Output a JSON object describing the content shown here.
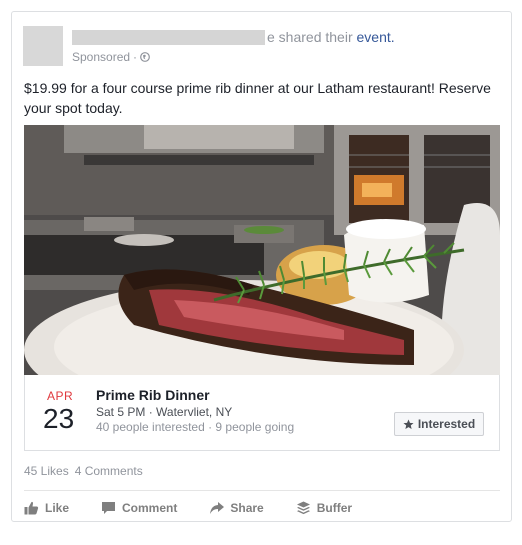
{
  "post": {
    "shared_suffix": "e shared their",
    "shared_link": "event.",
    "sponsored": "Sponsored",
    "dot": "·",
    "text": "$19.99 for a four course prime rib dinner at our Latham restaurant! Reserve your spot today."
  },
  "event": {
    "month": "APR",
    "day": "23",
    "title": "Prime Rib Dinner",
    "meta": "Sat 5 PM · Watervliet, NY",
    "stats": "40 people interested · 9 people going",
    "interested_label": "Interested"
  },
  "counts": {
    "likes": "45 Likes",
    "comments": "4 Comments"
  },
  "actions": {
    "like": "Like",
    "comment": "Comment",
    "share": "Share",
    "buffer": "Buffer"
  },
  "icons": {
    "globe": "globe-icon",
    "star": "star-icon",
    "like": "thumbs-up-icon",
    "comment": "comment-bubble-icon",
    "share": "share-arrow-icon",
    "buffer": "buffer-stack-icon"
  },
  "colors": {
    "link": "#365899",
    "month": "#e0393e",
    "muted": "#90949c"
  }
}
